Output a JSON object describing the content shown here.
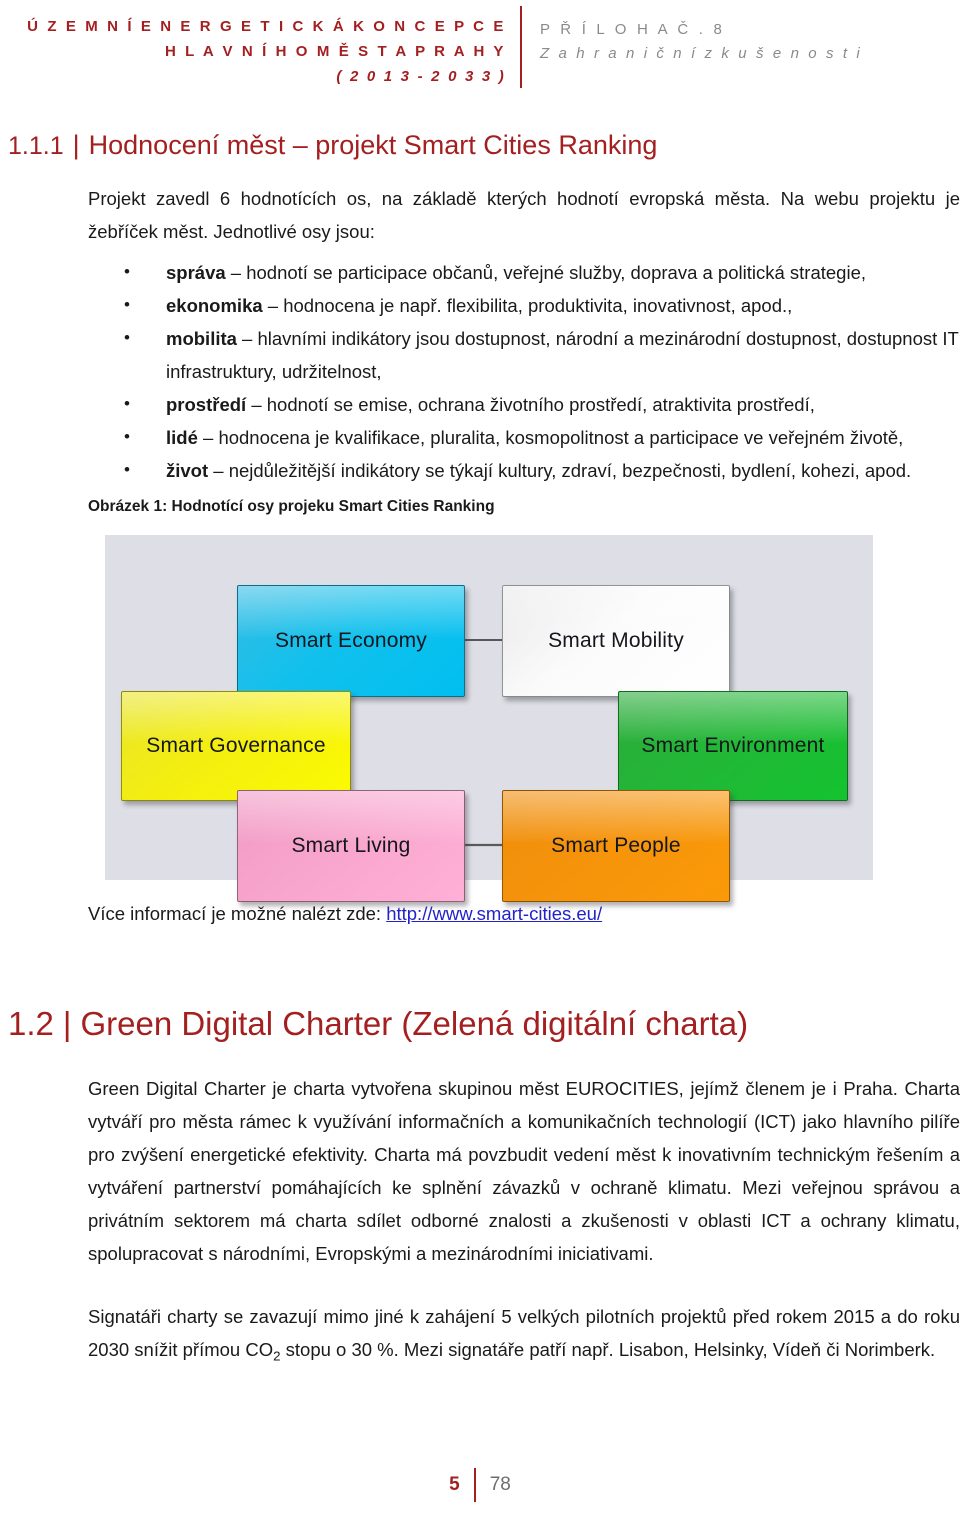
{
  "header": {
    "title_line1": "Ú Z E M N Í   E N E R G E T I C K Á   K O N C E P C E",
    "title_line2": "H L A V N Í H O   M Ě S T A   P R A H Y",
    "title_line3": "( 2 0 1 3 - 2 0 3 3 )",
    "annex_label": "P Ř Í L O H A   Č . 8",
    "annex_subtitle": "Z a h r a n i č n í   z k u š e n o s t i",
    "accent_color": "#A41F20",
    "muted_color": "#8a8a8a"
  },
  "section_111": {
    "number": "1.1.1",
    "bar": "|",
    "title": "Hodnocení měst – projekt Smart Cities Ranking",
    "intro": "Projekt zavedl 6 hodnotících os, na základě kterých hodnotí evropská města. Na webu projektu je žebříček měst. Jednotlivé osy jsou:",
    "bullets": [
      {
        "term": "správa",
        "text": " – hodnotí se participace občanů, veřejné služby, doprava a politická strategie,"
      },
      {
        "term": "ekonomika",
        "text": " – hodnocena je např. flexibilita, produktivita, inovativnost, apod.,"
      },
      {
        "term": "mobilita",
        "text": " – hlavními indikátory jsou dostupnost, národní a mezinárodní dostupnost, dostupnost IT infrastruktury, udržitelnost,"
      },
      {
        "term": "prostředí",
        "text": " – hodnotí se emise, ochrana životního prostředí, atraktivita prostředí,"
      },
      {
        "term": "lidé",
        "text": " – hodnocena je kvalifikace, pluralita, kosmopolitnost a participace ve veřejném životě,"
      },
      {
        "term": "život",
        "text": " – nejdůležitější indikátory se týkají kultury, zdraví, bezpečnosti, bydlení, kohezi, apod."
      }
    ],
    "figure_caption": "Obrázek 1: Hodnotící osy projeku Smart Cities Ranking",
    "link_prefix": "Více informací je možné nalézt zde: ",
    "link_text": "http://www.smart-cities.eu/"
  },
  "diagram": {
    "background_color": "#dedee6",
    "nodes": [
      {
        "id": "economy",
        "label": "Smart Economy",
        "color": "#00bff0"
      },
      {
        "id": "mobility",
        "label": "Smart Mobility",
        "color": "#ffffff"
      },
      {
        "id": "governance",
        "label": "Smart Governance",
        "color": "#fbfb00"
      },
      {
        "id": "environment",
        "label": "Smart Environment",
        "color": "#14c32f"
      },
      {
        "id": "living",
        "label": "Smart Living",
        "color": "#ffb0d6"
      },
      {
        "id": "people",
        "label": "Smart People",
        "color": "#fb9a08"
      }
    ]
  },
  "section_12": {
    "number": "1.2",
    "bar": "|",
    "title": "Green Digital Charter (Zelená digitální charta)",
    "paragraph_1": "Green Digital Charter je charta vytvořena skupinou měst EUROCITIES, jejímž členem je i Praha. Charta vytváří pro města rámec k využívání informačních a komunikačních technologií (ICT) jako hlavního pilíře pro zvýšení energetické efektivity. Charta má povzbudit vedení měst k inovativním technickým řešením a vytváření partnerství pomáhajících ke splnění závazků v ochraně klimatu. Mezi veřejnou správou a privátním sektorem má charta sdílet odborné znalosti a zkušenosti v oblasti ICT a ochrany klimatu, spolupracovat s národními, Evropskými a mezinárodními iniciativami.",
    "paragraph_2_part1": "Signatáři charty se zavazují mimo jiné k zahájení 5 velkých pilotních projektů před rokem 2015 a do roku 2030 snížit přímou CO",
    "paragraph_2_sub": "2",
    "paragraph_2_part2": " stopu o 30 %. Mezi signatáře patří např. Lisabon, Helsinky, Vídeň či Norimberk."
  },
  "footer": {
    "page_current": "5",
    "page_total": "78"
  }
}
